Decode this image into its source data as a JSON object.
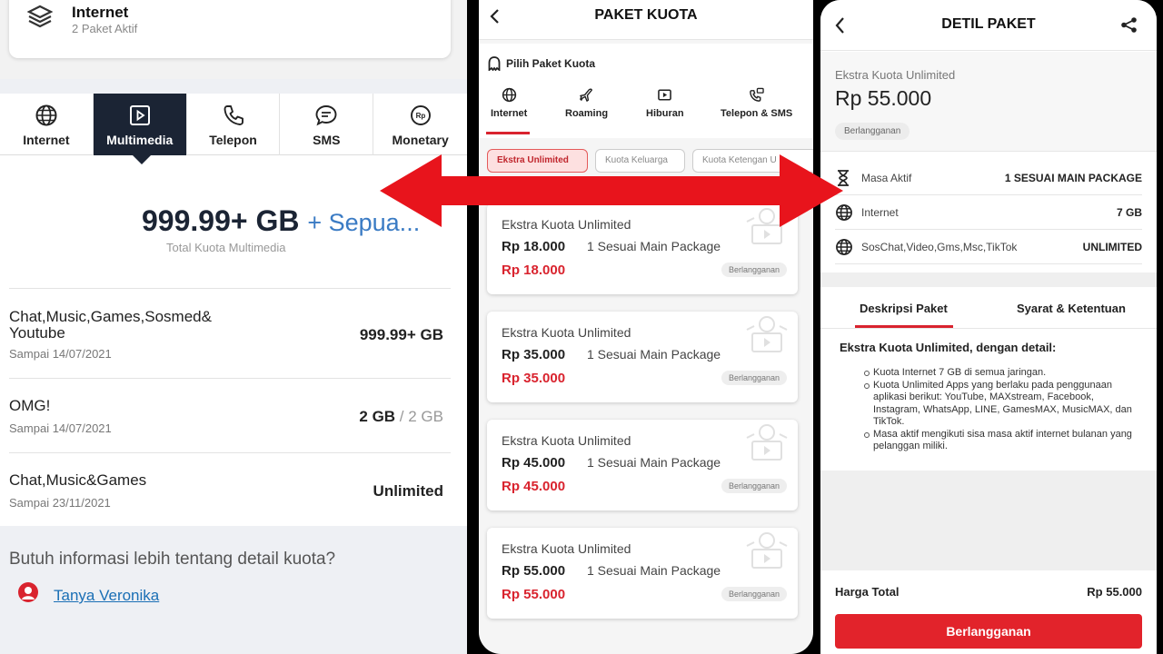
{
  "panel_left": {
    "card": {
      "title": "Internet",
      "subtitle": "2 Paket Aktif"
    },
    "tabs": [
      {
        "label": "Internet",
        "icon": "globe-icon"
      },
      {
        "label": "Multimedia",
        "icon": "play-icon",
        "active": true
      },
      {
        "label": "Telepon",
        "icon": "phone-icon"
      },
      {
        "label": "SMS",
        "icon": "chat-icon"
      },
      {
        "label": "Monetary",
        "icon": "rupiah-coin-icon"
      }
    ],
    "total": {
      "value": "999.99+ GB",
      "extra": "+ Sepua...",
      "label": "Total Kuota Multimedia"
    },
    "quotas": [
      {
        "name": "Chat,Music,Games,Sosmed&\nYoutube",
        "date": "Sampai 14/07/2021",
        "value": "999.99+ GB",
        "of": ""
      },
      {
        "name": "OMG!",
        "date": "Sampai 14/07/2021",
        "value": "2 GB",
        "of": " / 2 GB"
      },
      {
        "name": "Chat,Music&Games",
        "date": "Sampai 23/11/2021",
        "value": "Unlimited",
        "of": ""
      }
    ],
    "footer": {
      "question": "Butuh informasi lebih tentang detail kuota?",
      "link": "Tanya Veronika"
    }
  },
  "panel_middle": {
    "title": "PAKET KUOTA",
    "pick_label": "Pilih Paket Kuota",
    "tabs": [
      {
        "label": "Internet",
        "icon": "globe-icon"
      },
      {
        "label": "Roaming",
        "icon": "plane-icon"
      },
      {
        "label": "Hiburan",
        "icon": "play-icon"
      },
      {
        "label": "Telepon & SMS",
        "icon": "phone-sms-icon"
      }
    ],
    "chips": [
      "Ekstra Unlimited",
      "Kuota Keluarga",
      "Kuota Ketengan U"
    ],
    "packages": [
      {
        "name": "Ekstra Kuota Unlimited",
        "price": "Rp 18.000",
        "validity": "1 Sesuai Main Package",
        "price_red": "Rp 18.000",
        "badge": "Berlangganan"
      },
      {
        "name": "Ekstra Kuota Unlimited",
        "price": "Rp 35.000",
        "validity": "1 Sesuai Main Package",
        "price_red": "Rp 35.000",
        "badge": "Berlangganan"
      },
      {
        "name": "Ekstra Kuota Unlimited",
        "price": "Rp 45.000",
        "validity": "1 Sesuai Main Package",
        "price_red": "Rp 45.000",
        "badge": "Berlangganan"
      },
      {
        "name": "Ekstra Kuota Unlimited",
        "price": "Rp 55.000",
        "validity": "1 Sesuai Main Package",
        "price_red": "Rp 55.000",
        "badge": "Berlangganan"
      }
    ]
  },
  "panel_right": {
    "title": "DETIL PAKET",
    "package_name": "Ekstra Kuota Unlimited",
    "price": "Rp 55.000",
    "badge": "Berlangganan",
    "info": [
      {
        "label": "Masa Aktif",
        "value": "1 SESUAI MAIN PACKAGE",
        "icon": "hourglass-icon"
      },
      {
        "label": "Internet",
        "value": "7 GB",
        "icon": "globe-icon"
      },
      {
        "label": "SosChat,Video,Gms,Msc,TikTok",
        "value": "UNLIMITED",
        "icon": "globe-icon"
      }
    ],
    "tabs": [
      "Deskripsi Paket",
      "Syarat & Ketentuan"
    ],
    "desc_heading": "Ekstra Kuota Unlimited, dengan detail:",
    "desc_items": [
      "Kuota Internet 7 GB di semua jaringan.",
      "Kuota Unlimited Apps yang berlaku pada penggunaan aplikasi berikut: YouTube, MAXstream, Facebook, Instagram, WhatsApp, LINE, GamesMAX, MusicMAX, dan TikTok.",
      "Masa aktif mengikuti sisa masa aktif internet bulanan yang pelanggan miliki."
    ],
    "total_label": "Harga Total",
    "total_value": "Rp 55.000",
    "button": "Berlangganan"
  },
  "colors": {
    "accent_red": "#e2232b",
    "navy": "#1b2434",
    "link_blue": "#1a6fb5",
    "arrow_red": "#e8141c"
  }
}
